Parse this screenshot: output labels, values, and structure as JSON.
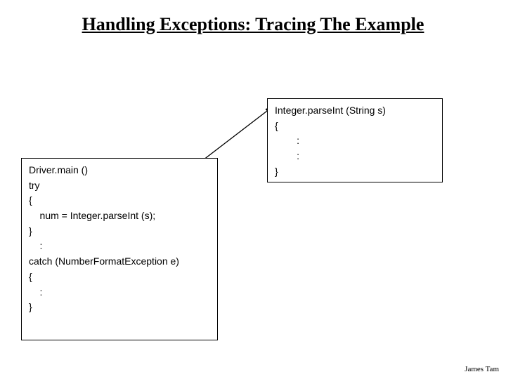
{
  "title": "Handling Exceptions: Tracing The Example",
  "left": {
    "l1": "Driver.main ()",
    "l2": "try",
    "l3": "{",
    "l4": "    num = Integer.parseInt (s);",
    "l5": "}",
    "l6": "    :",
    "l7": "catch (NumberFormatException e)",
    "l8": "{",
    "l9": "    :",
    "l10": "}"
  },
  "right": {
    "r1": "Integer.parseInt (String s)",
    "r2": "{",
    "r3": "        :",
    "r4": "        :",
    "r5": "}"
  },
  "footer": "James Tam"
}
